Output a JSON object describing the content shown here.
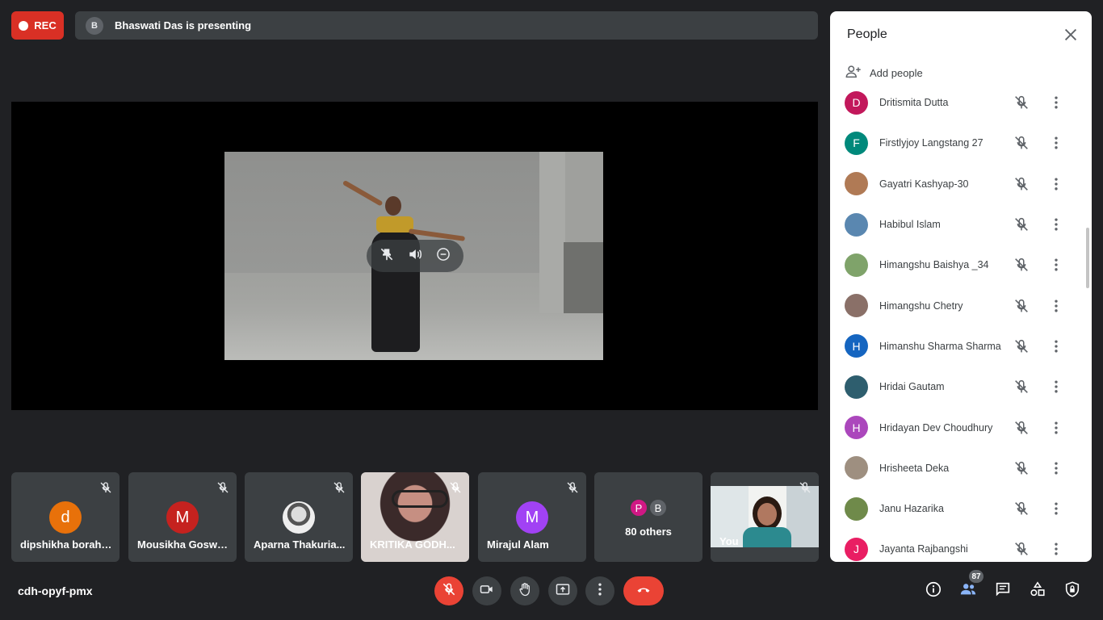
{
  "header": {
    "rec_label": "REC",
    "presenter_initial": "B",
    "presenting_text": "Bhaswati Das is presenting"
  },
  "tiles": [
    {
      "name": "dipshikha borah_...",
      "initial": "d",
      "color": "#e8710a"
    },
    {
      "name": "Mousikha Goswa...",
      "initial": "M",
      "color": "#c5221f"
    },
    {
      "name": "Aparna Thakuria...",
      "initial": ""
    },
    {
      "name": "KRITIKA GODH...",
      "initial": ""
    },
    {
      "name": "Mirajul Alam",
      "initial": "M",
      "color": "#a142f4"
    },
    {
      "name": "80 others",
      "initials": [
        "P",
        "B"
      ],
      "colors": [
        "#d01884",
        "#5f6368"
      ]
    },
    {
      "name": "You",
      "initial": ""
    }
  ],
  "bottom_bar": {
    "meeting_code": "cdh-opyf-pmx",
    "participant_count": "87"
  },
  "people_panel": {
    "title": "People",
    "add_people_label": "Add people",
    "people": [
      {
        "name": "Dritismita Dutta",
        "initial": "D",
        "color": "#c2185b"
      },
      {
        "name": "Firstlyjoy Langstang 27",
        "initial": "F",
        "color": "#00897b"
      },
      {
        "name": "Gayatri Kashyap-30",
        "initial": "",
        "color": "#b07a55"
      },
      {
        "name": "Habibul Islam",
        "initial": "",
        "color": "#5a87b0"
      },
      {
        "name": "Himangshu Baishya _34",
        "initial": "",
        "color": "#7fa36a"
      },
      {
        "name": "Himangshu Chetry",
        "initial": "",
        "color": "#8a7068"
      },
      {
        "name": "Himanshu Sharma Sharma",
        "initial": "H",
        "color": "#1565c0"
      },
      {
        "name": "Hridai Gautam",
        "initial": "",
        "color": "#2e5e6e"
      },
      {
        "name": "Hridayan Dev Choudhury",
        "initial": "H",
        "color": "#ab47bc"
      },
      {
        "name": "Hrisheeta Deka",
        "initial": "",
        "color": "#9e8f80"
      },
      {
        "name": "Janu Hazarika",
        "initial": "",
        "color": "#6f8a4a"
      },
      {
        "name": "Jayanta Rajbangshi",
        "initial": "J",
        "color": "#e91e63"
      }
    ]
  }
}
